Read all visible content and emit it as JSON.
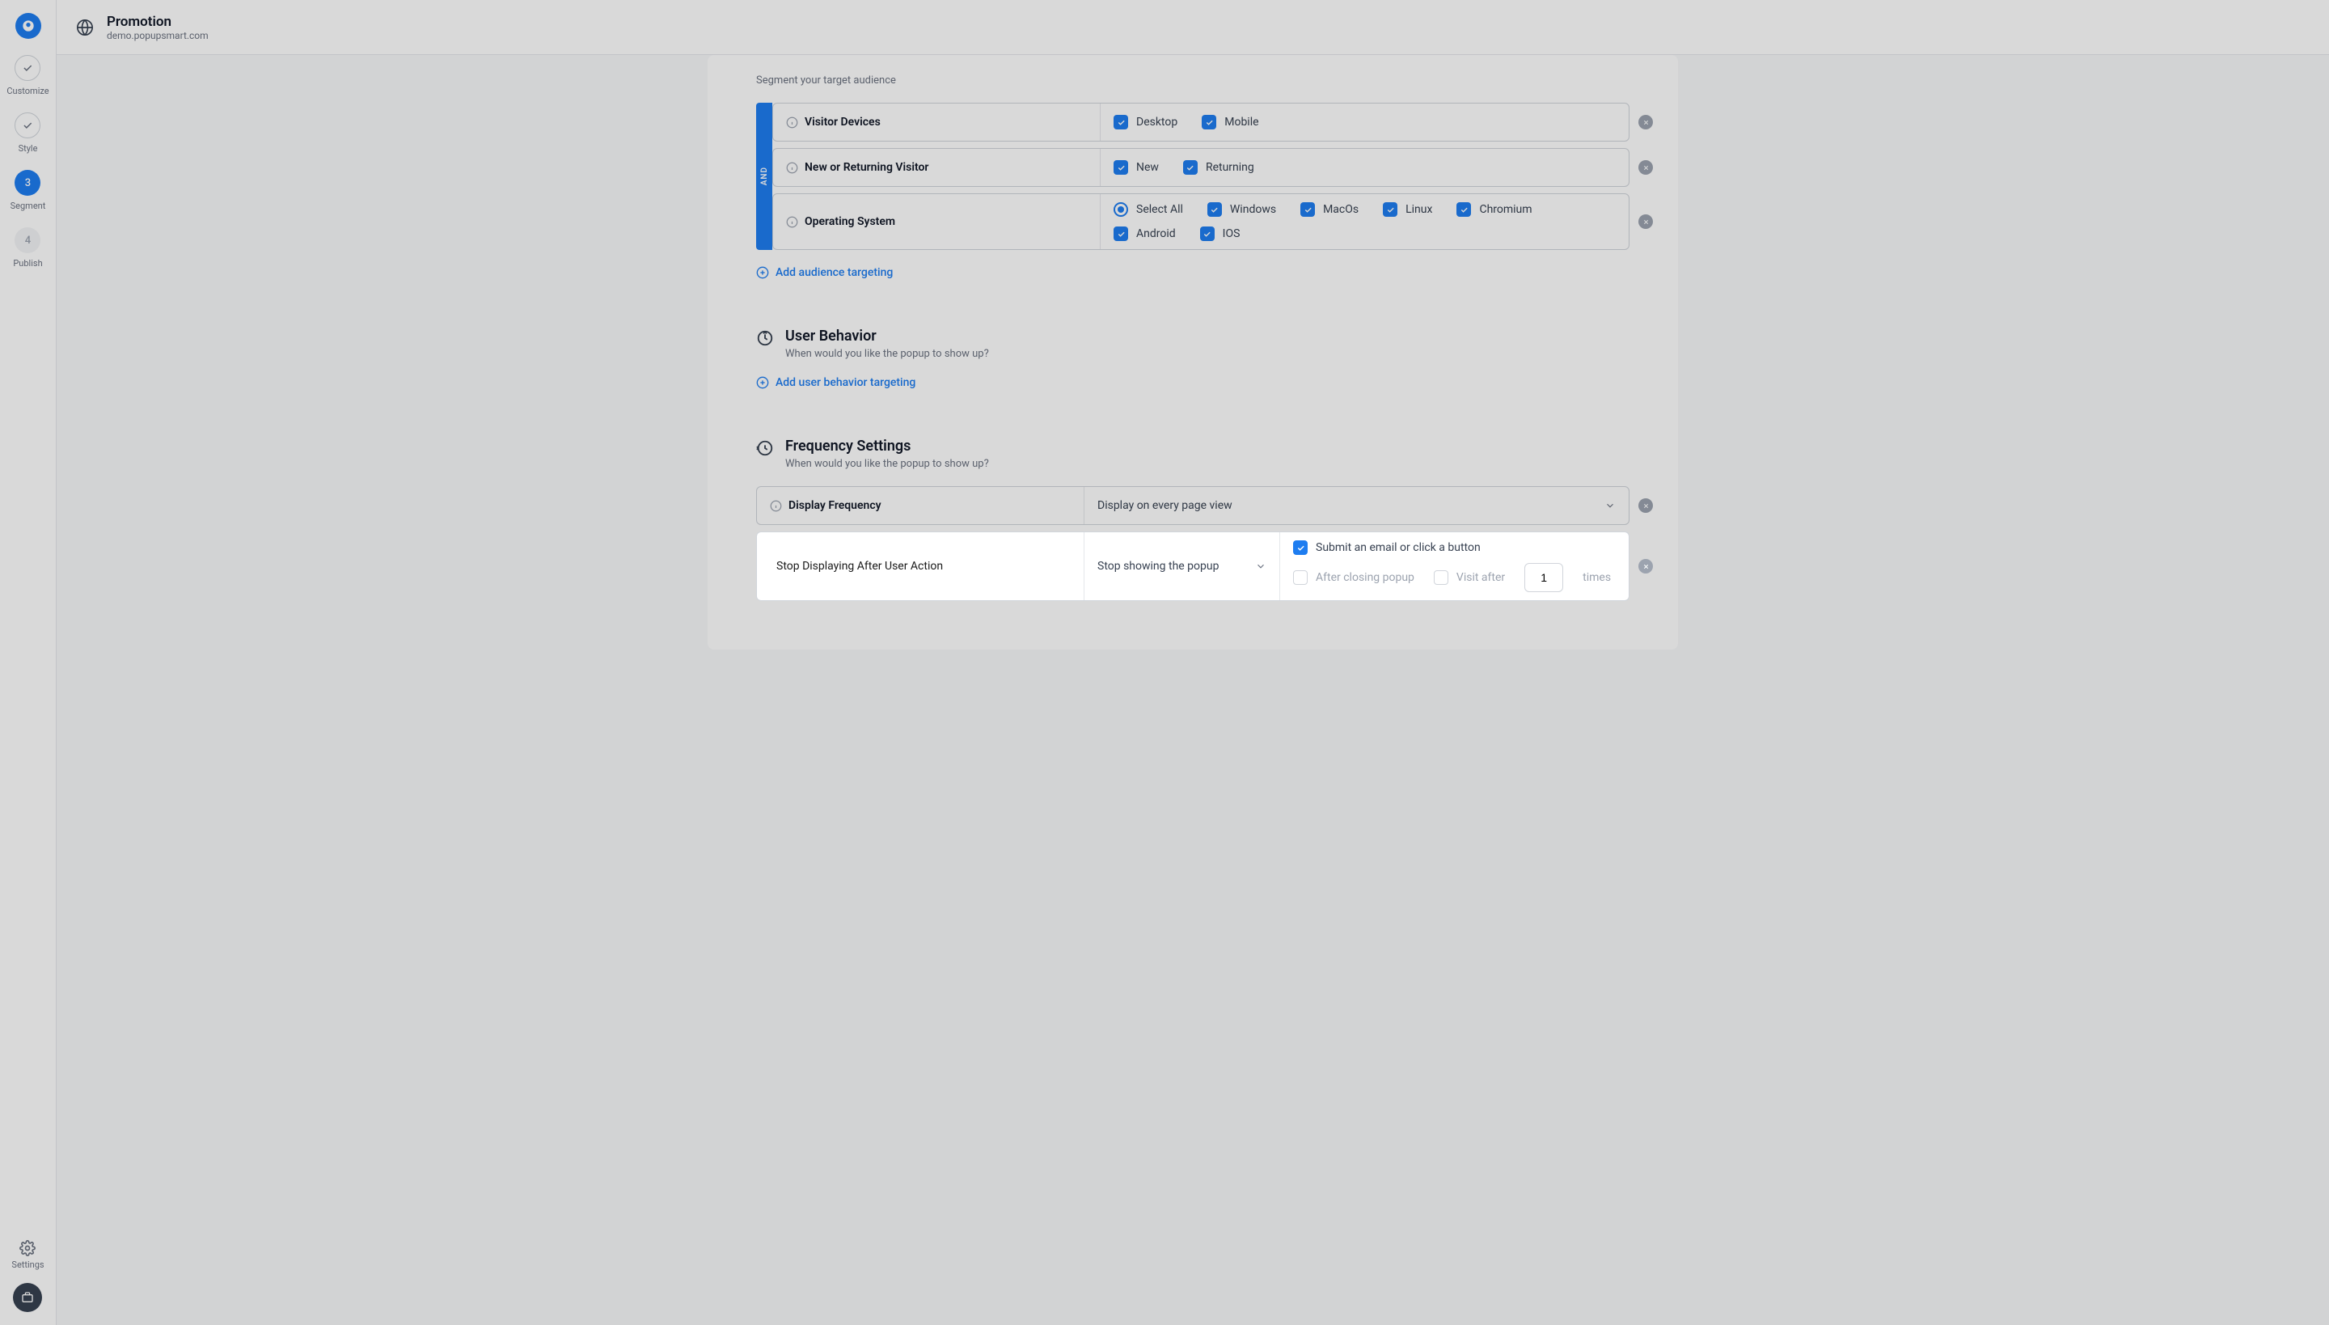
{
  "brand": {
    "color": "#1e7df0"
  },
  "sidebar": {
    "steps": [
      {
        "label": "Customize"
      },
      {
        "label": "Style"
      },
      {
        "num": "3",
        "label": "Segment"
      },
      {
        "num": "4",
        "label": "Publish"
      }
    ],
    "settings": "Settings"
  },
  "topbar": {
    "title": "Promotion",
    "domain": "demo.popupsmart.com"
  },
  "audience": {
    "sub": "Segment your target audience",
    "and": "AND",
    "rules": [
      {
        "label": "Visitor Devices",
        "opts": [
          "Desktop",
          "Mobile"
        ]
      },
      {
        "label": "New or Returning Visitor",
        "opts": [
          "New",
          "Returning"
        ]
      },
      {
        "label": "Operating System",
        "select_all": "Select All",
        "opts": [
          "Windows",
          "MacOs",
          "Linux",
          "Chromium",
          "Android",
          "IOS"
        ]
      }
    ],
    "add": "Add audience targeting"
  },
  "behavior": {
    "title": "User Behavior",
    "sub": "When would you like the popup to show up?",
    "add": "Add user behavior targeting"
  },
  "frequency": {
    "title": "Frequency Settings",
    "sub": "When would you like the popup to show up?",
    "display": {
      "label": "Display Frequency",
      "value": "Display on every page view"
    },
    "stop": {
      "label": "Stop Displaying After User Action",
      "select": "Stop showing the popup",
      "submit": "Submit an email or click a button",
      "close": "After closing popup",
      "visit": "Visit after",
      "visit_n": "1",
      "times": "times"
    }
  }
}
